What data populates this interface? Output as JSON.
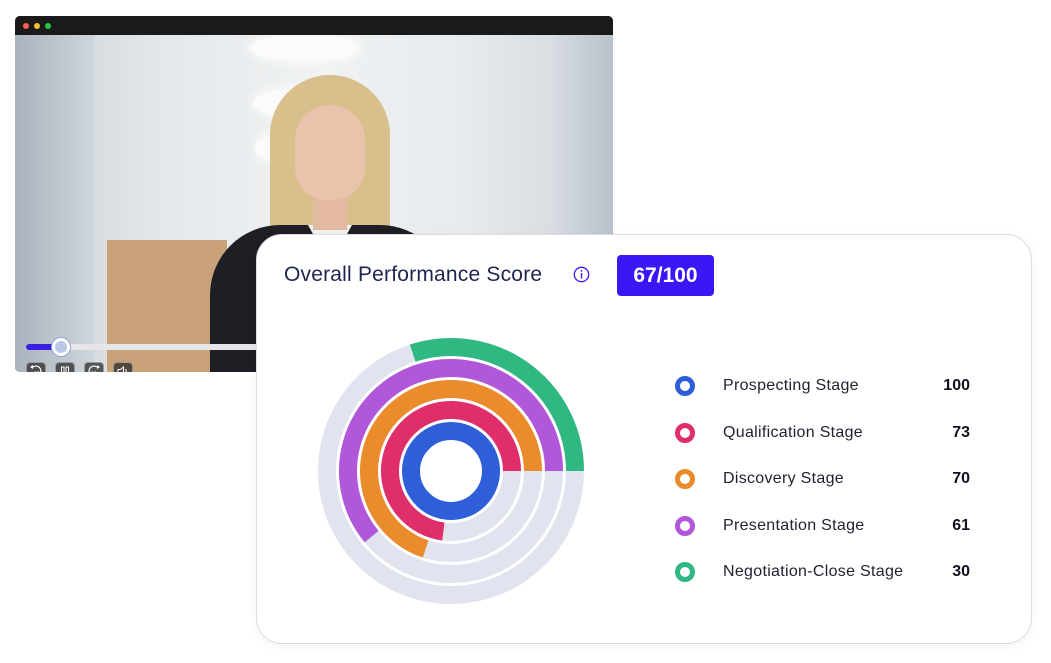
{
  "video": {
    "progress": 0.06,
    "controls": [
      {
        "name": "rewind-10-icon",
        "glyph": "rewind"
      },
      {
        "name": "pause-icon",
        "glyph": "pause"
      },
      {
        "name": "forward-10-icon",
        "glyph": "forward"
      },
      {
        "name": "volume-icon",
        "glyph": "volume"
      }
    ],
    "rewind_text": "10",
    "forward_text": "10"
  },
  "card": {
    "title": "Overall Performance Score",
    "score": "67/100",
    "accent": "#3b17f5",
    "track_color": "#e1e4ee"
  },
  "chart_data": {
    "type": "radial-bar",
    "max": 100,
    "series": [
      {
        "name": "Prospecting Stage",
        "value": 100,
        "color": "#2f5fd8"
      },
      {
        "name": "Qualification Stage",
        "value": 73,
        "color": "#df2e69"
      },
      {
        "name": "Discovery Stage",
        "value": 70,
        "color": "#ea8c2c"
      },
      {
        "name": "Presentation Stage",
        "value": 61,
        "color": "#b058d9"
      },
      {
        "name": "Negotiation-Close Stage",
        "value": 30,
        "color": "#2fb882"
      }
    ]
  }
}
